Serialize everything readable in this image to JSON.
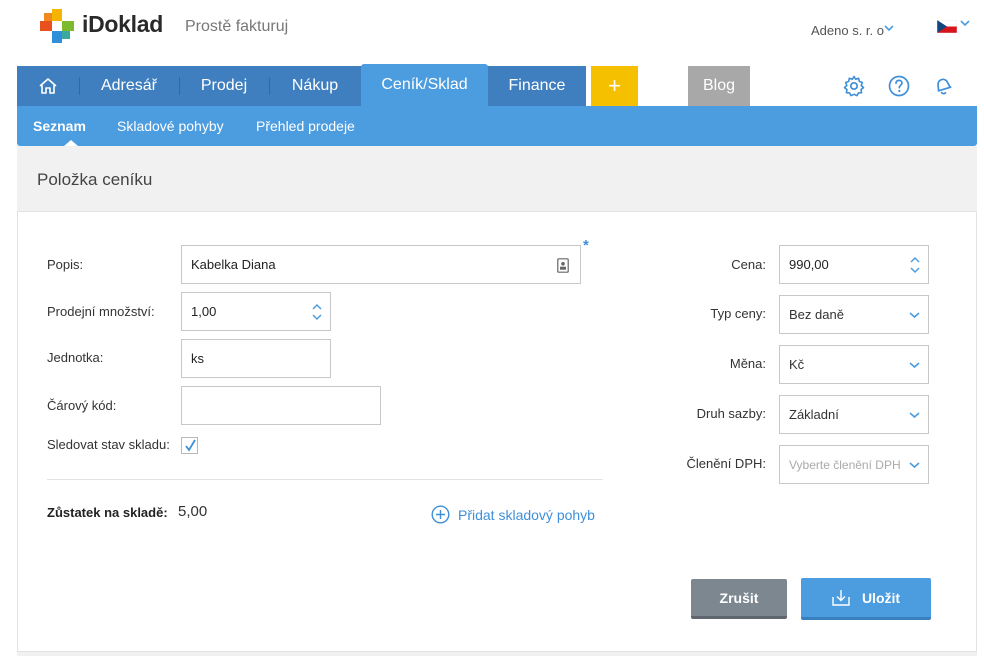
{
  "header": {
    "brand": "iDoklad",
    "tagline": "Prostě fakturuj",
    "company": "Adeno s. r. o"
  },
  "nav": {
    "items": [
      "Adresář",
      "Prodej",
      "Nákup",
      "Ceník/Sklad",
      "Finance"
    ],
    "active": "Ceník/Sklad",
    "plus": "+",
    "blog": "Blog"
  },
  "subnav": {
    "items": [
      "Seznam",
      "Skladové pohyby",
      "Přehled prodeje"
    ],
    "active": "Seznam"
  },
  "page": {
    "title": "Položka ceníku"
  },
  "form": {
    "popis": {
      "label": "Popis:",
      "value": "Kabelka Diana"
    },
    "mnozstvi": {
      "label": "Prodejní množství:",
      "value": "1,00"
    },
    "jednotka": {
      "label": "Jednotka:",
      "value": "ks"
    },
    "kod": {
      "label": "Čárový kód:",
      "value": ""
    },
    "sklad": {
      "label": "Sledovat stav skladu:",
      "checked": true
    },
    "required_mark": "*",
    "cena": {
      "label": "Cena:",
      "value": "990,00"
    },
    "typ_ceny": {
      "label": "Typ ceny:",
      "value": "Bez daně"
    },
    "mena": {
      "label": "Měna:",
      "value": "Kč"
    },
    "druh_sazby": {
      "label": "Druh sazby:",
      "value": "Základní"
    },
    "cleneni": {
      "label": "Členění DPH:",
      "placeholder": "Vyberte členění DPH"
    }
  },
  "stock": {
    "label": "Zůstatek na skladě:",
    "value": "5,00"
  },
  "actions": {
    "add_move": "Přidat skladový pohyb",
    "cancel": "Zrušit",
    "save": "Uložit"
  },
  "colors": {
    "primary": "#3f7fbf",
    "accent": "#4c9ce0",
    "plus": "#f5c000"
  }
}
